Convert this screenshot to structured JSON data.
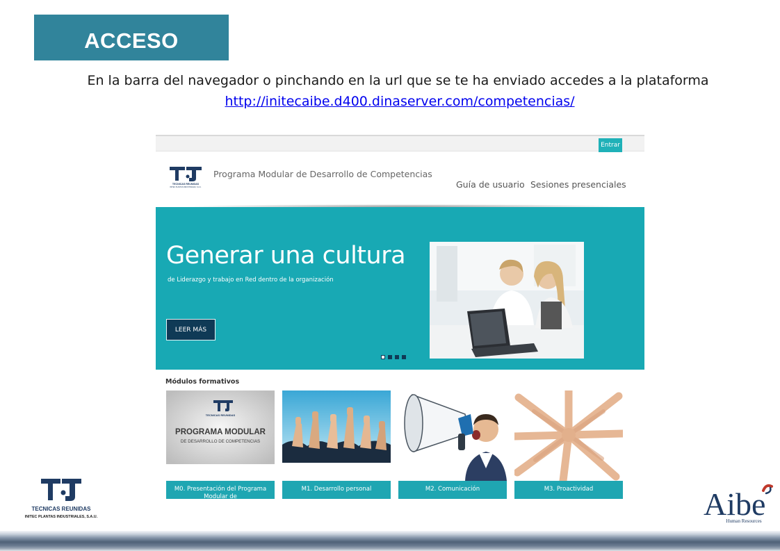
{
  "slide": {
    "title": "ACCESO",
    "intro": "En la barra del navegador o pinchando en la url que se te ha enviado accedes a la plataforma",
    "url": "http://initecaibe.d400.dinaserver.com/competencias/"
  },
  "screenshot": {
    "topbar": {
      "enter_label": "Entrar"
    },
    "header": {
      "logo_text": "TECNICAS REUNIDAS",
      "logo_subtext": "INITEC PLANTAS INDUSTRIALES, S.A.U.",
      "site_title": "Programa Modular de Desarrollo de Competencias",
      "nav": [
        "Guía de usuario",
        "Sesiones presenciales"
      ]
    },
    "hero": {
      "title": "Generar una cultura",
      "subtitle": "de Liderazgo y trabajo en Red dentro de la organización",
      "button": "LEER MÁS",
      "slides_total": 4,
      "active_slide": 1
    },
    "modules": {
      "heading": "Módulos formativos",
      "items": [
        {
          "label": "M0. Presentación del Programa Modular de",
          "thumb_title": "PROGRAMA MODULAR",
          "thumb_subtitle": "DE DESARROLLO DE COMPETENCIAS",
          "thumb_logo_text": "TECNICAS REUNIDAS"
        },
        {
          "label": "M1. Desarrollo personal"
        },
        {
          "label": "M2. Comunicación"
        },
        {
          "label": "M3. Proactividad"
        }
      ]
    }
  },
  "footer": {
    "left_logo": {
      "name": "TECNICAS REUNIDAS",
      "subtext": "INITEC PLANTAS INDUSTRIALES, S.A.U."
    },
    "right_logo": {
      "name": "Aibe",
      "subtext": "Human Resources"
    }
  },
  "colors": {
    "title_box": "#31849b",
    "teal": "#18a9b4",
    "navy": "#0f3a56",
    "card_label": "#1fa6b2",
    "aibe_text": "#1f3b63",
    "aibe_accent": "#c0392b"
  }
}
